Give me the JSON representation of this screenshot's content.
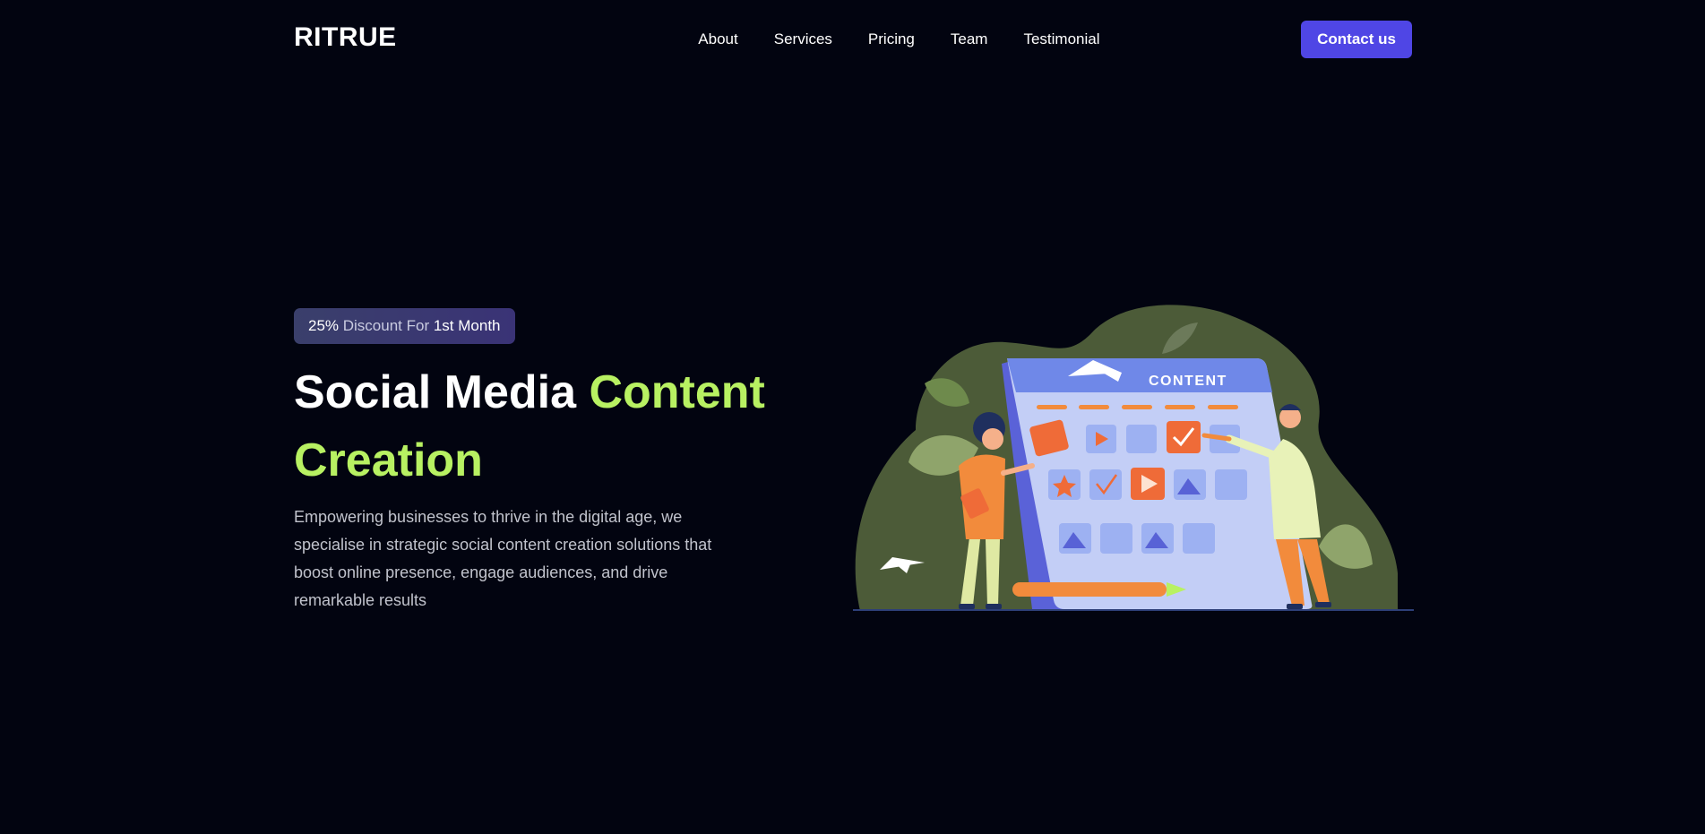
{
  "header": {
    "logo": "RITRUE",
    "nav": [
      {
        "label": "About"
      },
      {
        "label": "Services"
      },
      {
        "label": "Pricing"
      },
      {
        "label": "Team"
      },
      {
        "label": "Testimonial"
      }
    ],
    "contact_label": "Contact us"
  },
  "hero": {
    "badge": {
      "percent": "25%",
      "middle": " Discount For ",
      "end": "1st Month"
    },
    "title": {
      "part1": "Social Media ",
      "accent": "Content Creation"
    },
    "description": "Empowering businesses to thrive in the digital age, we specialise in strategic social content creation solutions that boost online presence, engage audiences, and drive remarkable results",
    "illustration_label": "CONTENT"
  },
  "colors": {
    "background": "#020410",
    "accent_green": "#b8f162",
    "button": "#4f46e5"
  }
}
